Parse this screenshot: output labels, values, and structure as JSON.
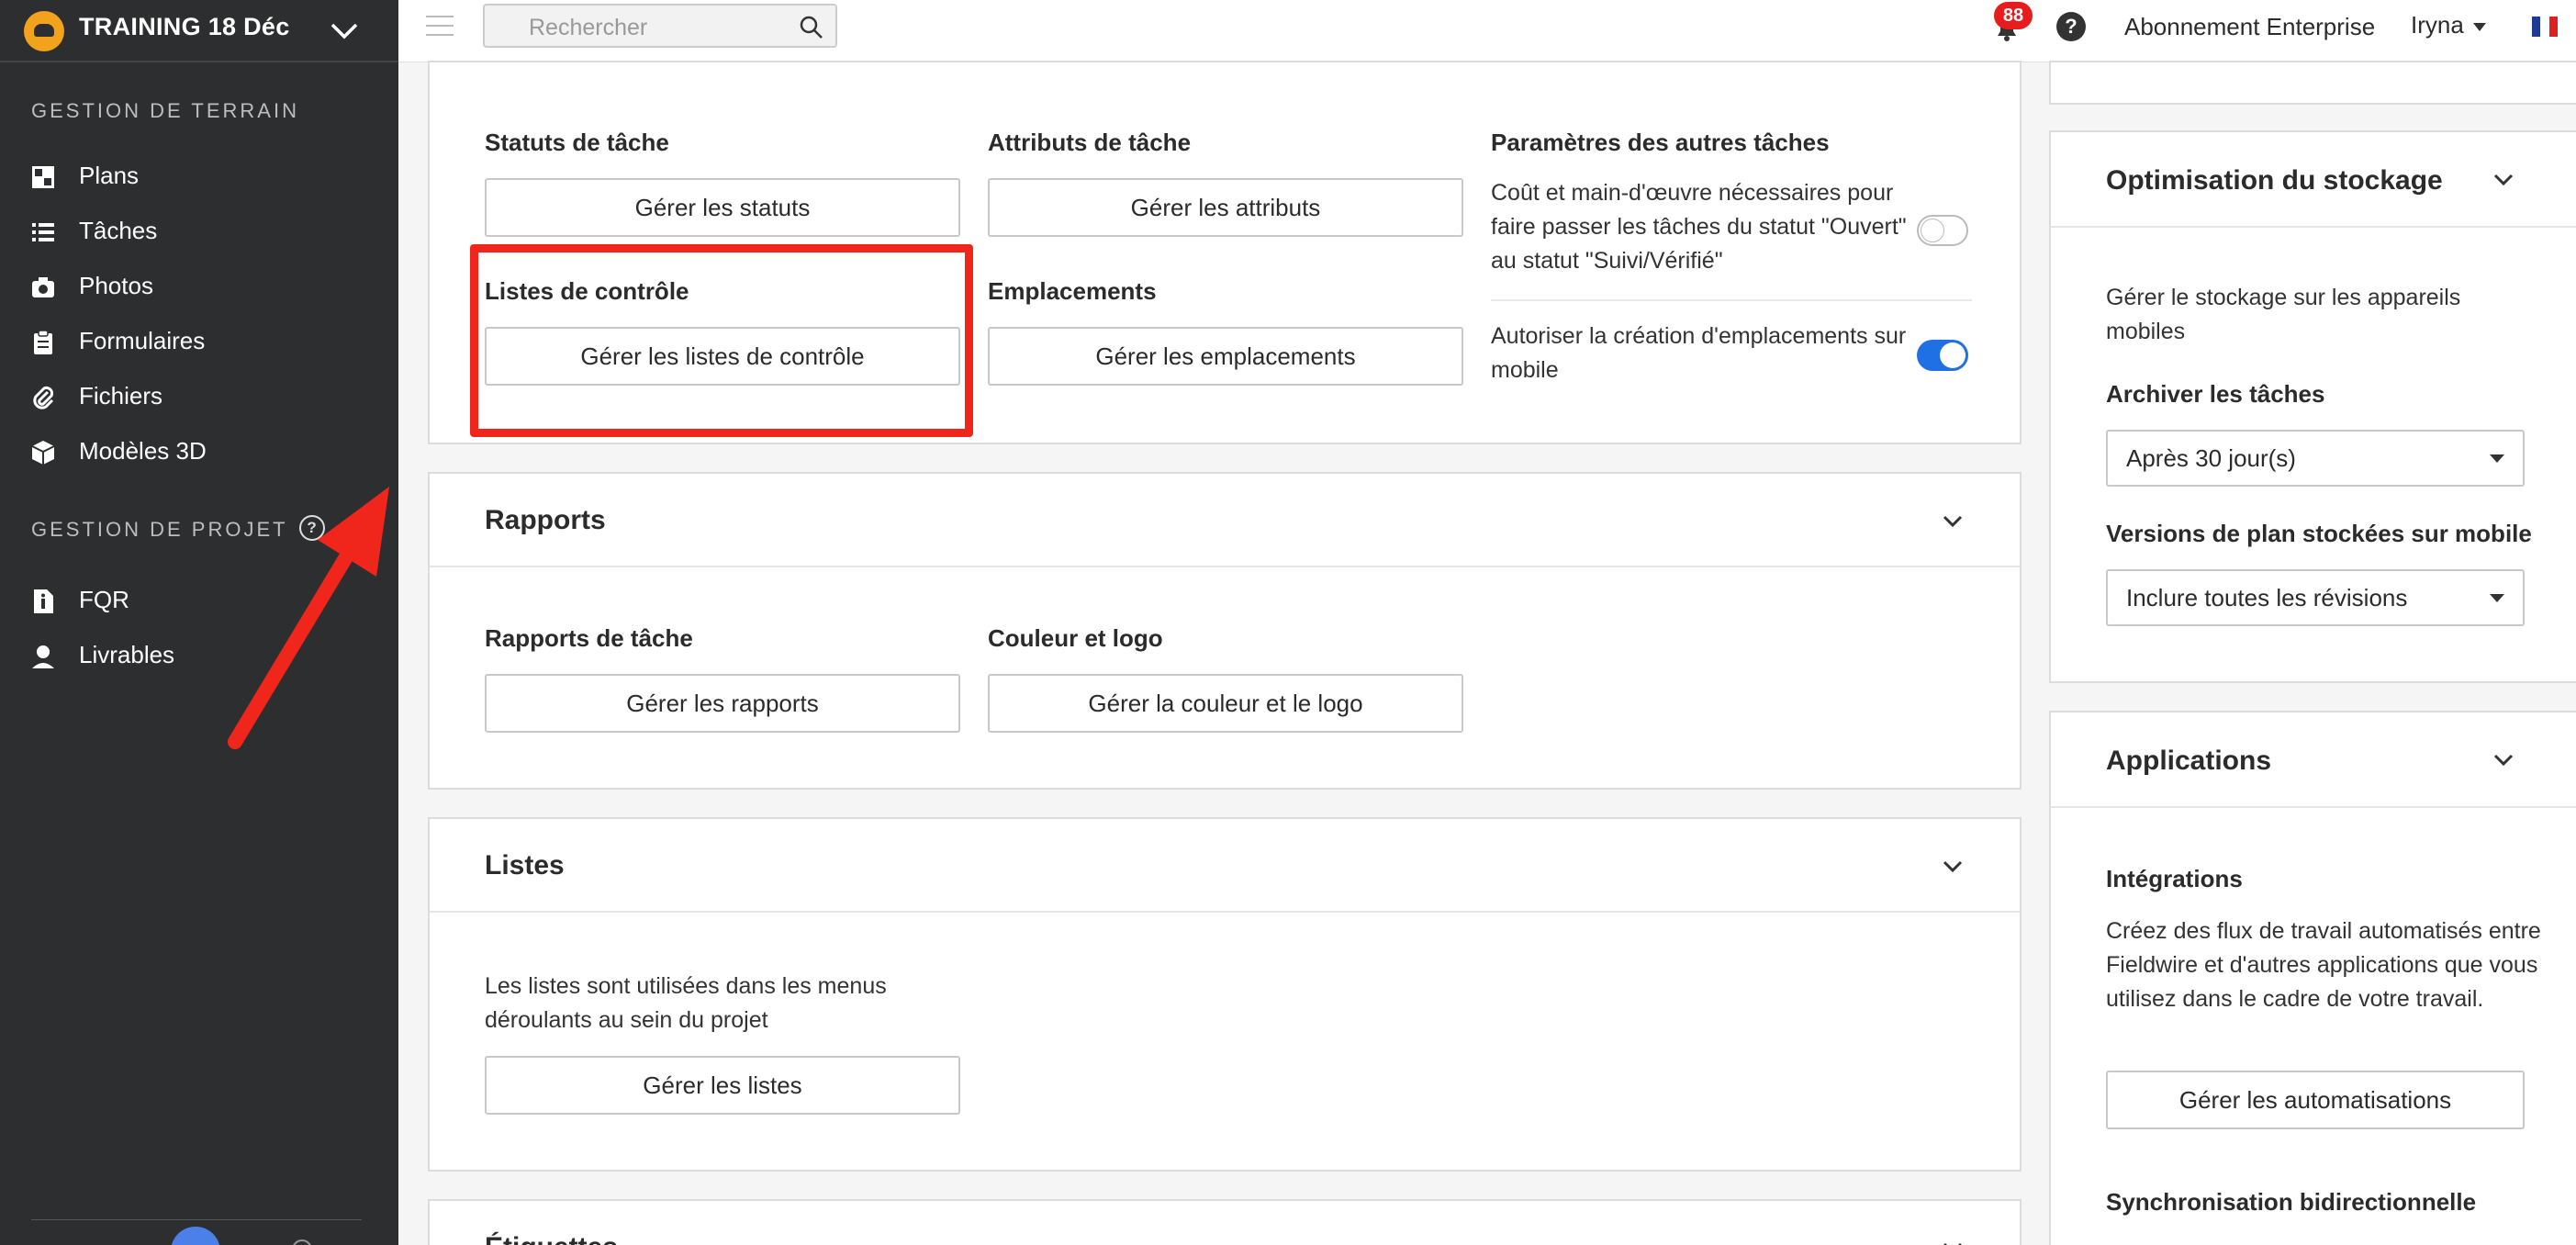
{
  "project": {
    "name": "TRAINING 18 Déc"
  },
  "sidebar": {
    "field_section": "GESTION DE TERRAIN",
    "field_items": [
      {
        "label": "Plans",
        "icon": "map-icon"
      },
      {
        "label": "Tâches",
        "icon": "list-icon"
      },
      {
        "label": "Photos",
        "icon": "camera-icon"
      },
      {
        "label": "Formulaires",
        "icon": "clipboard-icon"
      },
      {
        "label": "Fichiers",
        "icon": "paperclip-icon"
      },
      {
        "label": "Modèles 3D",
        "icon": "cube-icon"
      }
    ],
    "project_section": "GESTION DE PROJET",
    "project_items": [
      {
        "label": "FQR",
        "icon": "document-icon"
      },
      {
        "label": "Livrables",
        "icon": "person-icon"
      }
    ]
  },
  "topbar": {
    "search_placeholder": "Rechercher",
    "notifications": "88",
    "help": "?",
    "subscription": "Abonnement Enterprise",
    "user": "Iryna"
  },
  "tasks_card": {
    "statuses_label": "Statuts de tâche",
    "statuses_button": "Gérer les statuts",
    "attributes_label": "Attributs de tâche",
    "attributes_button": "Gérer les attributs",
    "other_label": "Paramètres des autres tâches",
    "cost_text": "Coût et main-d'œuvre nécessaires pour faire passer les tâches du statut \"Ouvert\" au statut \"Suivi/Vérifié\"",
    "cost_toggle": false,
    "checklists_label": "Listes de contrôle",
    "checklists_button": "Gérer les listes de contrôle",
    "locations_label": "Emplacements",
    "locations_button": "Gérer les emplacements",
    "mobile_locations_text": "Autoriser la création d'emplacements sur mobile",
    "mobile_locations_toggle": true
  },
  "reports_card": {
    "title": "Rapports",
    "task_reports_label": "Rapports de tâche",
    "task_reports_button": "Gérer les rapports",
    "color_label": "Couleur et logo",
    "color_button": "Gérer la couleur et le logo"
  },
  "lists_card": {
    "title": "Listes",
    "description": "Les listes sont utilisées dans les menus déroulants au sein du projet",
    "button": "Gérer les listes"
  },
  "tags_card": {
    "title": "Étiquettes"
  },
  "storage_card": {
    "title": "Optimisation du stockage",
    "description": "Gérer le stockage sur les appareils mobiles",
    "archive_label": "Archiver les tâches",
    "archive_value": "Après 30 jour(s)",
    "versions_label": "Versions de plan stockées sur mobile",
    "versions_value": "Inclure toutes les révisions"
  },
  "apps_card": {
    "title": "Applications",
    "integrations_label": "Intégrations",
    "integrations_text": "Créez des flux de travail automatisés entre Fieldwire et d'autres applications que vous utilisez dans le cadre de votre travail.",
    "automations_button": "Gérer les automatisations",
    "sync_label": "Synchronisation bidirectionnelle"
  },
  "colors": {
    "accent": "#1f6fe5",
    "highlight": "#f0261c",
    "sidebar": "#2d2e30",
    "badge": "#e81c1c"
  }
}
